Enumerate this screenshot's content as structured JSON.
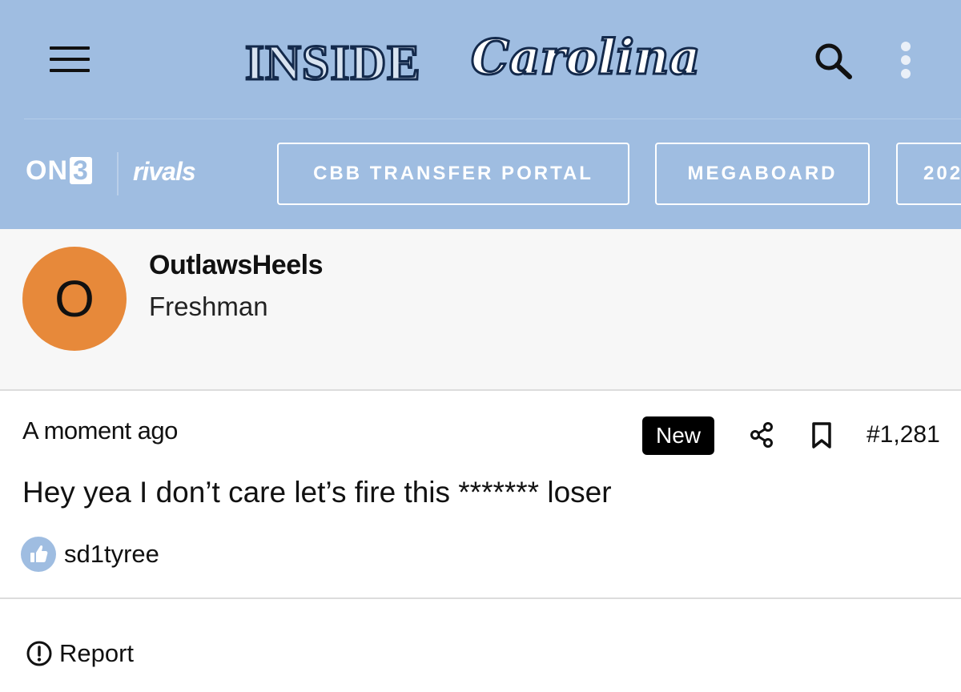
{
  "header": {
    "logo_primary": "INSIDE",
    "logo_script": "Carolina",
    "brand_on3": "ON",
    "brand_on3_num": "3",
    "brand_rivals": "rivals",
    "nav_pills": [
      "CBB TRANSFER PORTAL",
      "MEGABOARD",
      "202"
    ],
    "icons": [
      "menu-icon",
      "search-icon",
      "more-vert-icon"
    ]
  },
  "author": {
    "avatar_initial": "O",
    "username": "OutlawsHeels",
    "rank": "Freshman",
    "avatar_color": "#e7893a"
  },
  "post": {
    "timestamp": "A moment ago",
    "badge": "New",
    "post_number": "#1,281",
    "body": "Hey yea I don’t care let’s fire this ******* loser",
    "liked_by": "sd1tyree",
    "report_label": "Report",
    "icons": [
      "share-icon",
      "bookmark-icon",
      "thumbs-up-icon",
      "alert-circle-icon"
    ]
  },
  "colors": {
    "header_bg": "#9fbde1",
    "navy": "#13294b",
    "author_bg": "#f7f7f7"
  }
}
